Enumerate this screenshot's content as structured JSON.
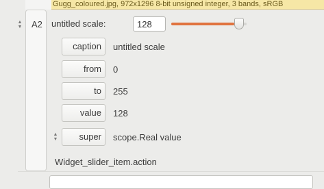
{
  "info_bar": {
    "text": "Gugg_coloured.jpg, 972x1296 8-bit unsigned integer, 3 bands, sRGB"
  },
  "row": {
    "label": "A2"
  },
  "slider": {
    "label": "untitled scale:",
    "value": "128",
    "fraction": 0.84,
    "accent_color": "#e0733f"
  },
  "properties": [
    {
      "name": "caption",
      "value": "untitled scale"
    },
    {
      "name": "from",
      "value": "0"
    },
    {
      "name": "to",
      "value": "255"
    },
    {
      "name": "value",
      "value": "128"
    },
    {
      "name": "super",
      "value": "scope.Real value"
    }
  ],
  "action": {
    "label": "Widget_slider_item.action"
  },
  "icons": {
    "updown": "spin-up-down-icon"
  }
}
